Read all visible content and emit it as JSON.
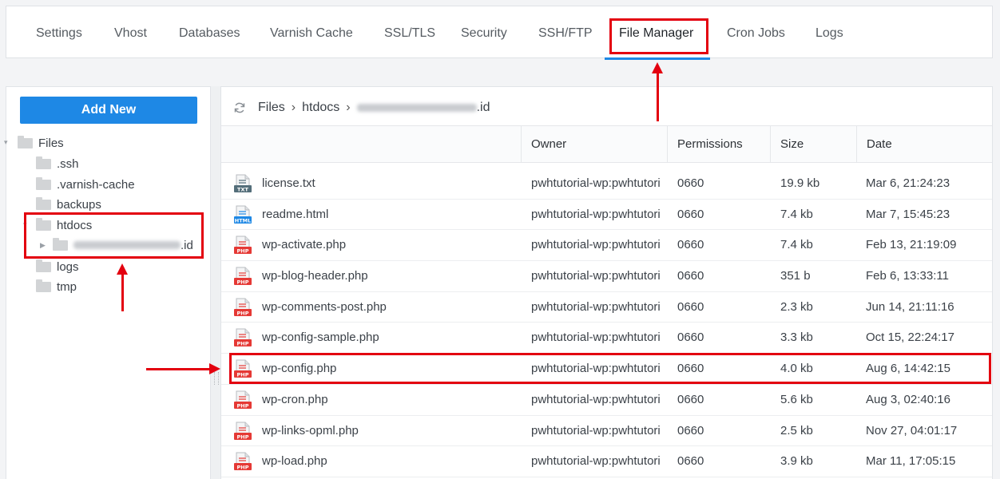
{
  "tabs": [
    "Settings",
    "Vhost",
    "Databases",
    "Varnish Cache",
    "SSL/TLS",
    "Security",
    "SSH/FTP",
    "File Manager",
    "Cron Jobs",
    "Logs"
  ],
  "active_tab": "File Manager",
  "left": {
    "add_new_label": "Add New",
    "tree": {
      "root": "Files",
      "items": [
        ".ssh",
        ".varnish-cache",
        "backups",
        "htdocs",
        "logs",
        "tmp"
      ],
      "htdocs_child_suffix": ".id"
    }
  },
  "breadcrumb": {
    "root": "Files",
    "folder": "htdocs",
    "sep": "›",
    "site_suffix": ".id"
  },
  "columns": {
    "name": "",
    "owner": "Owner",
    "permissions": "Permissions",
    "size": "Size",
    "date": "Date"
  },
  "files": [
    {
      "name": "license.txt",
      "icon": "txt-file-icon",
      "owner": "pwhtutorial-wp:pwhtutori",
      "perm": "0660",
      "size": "19.9 kb",
      "date": "Mar 6, 21:24:23"
    },
    {
      "name": "readme.html",
      "icon": "html-file-icon",
      "owner": "pwhtutorial-wp:pwhtutori",
      "perm": "0660",
      "size": "7.4 kb",
      "date": "Mar 7, 15:45:23"
    },
    {
      "name": "wp-activate.php",
      "icon": "php-file-icon",
      "owner": "pwhtutorial-wp:pwhtutori",
      "perm": "0660",
      "size": "7.4 kb",
      "date": "Feb 13, 21:19:09"
    },
    {
      "name": "wp-blog-header.php",
      "icon": "php-file-icon",
      "owner": "pwhtutorial-wp:pwhtutori",
      "perm": "0660",
      "size": "351 b",
      "date": "Feb 6, 13:33:11"
    },
    {
      "name": "wp-comments-post.php",
      "icon": "php-file-icon",
      "owner": "pwhtutorial-wp:pwhtutori",
      "perm": "0660",
      "size": "2.3 kb",
      "date": "Jun 14, 21:11:16"
    },
    {
      "name": "wp-config-sample.php",
      "icon": "php-file-icon",
      "owner": "pwhtutorial-wp:pwhtutori",
      "perm": "0660",
      "size": "3.3 kb",
      "date": "Oct 15, 22:24:17"
    },
    {
      "name": "wp-config.php",
      "icon": "php-file-icon",
      "owner": "pwhtutorial-wp:pwhtutori",
      "perm": "0660",
      "size": "4.0 kb",
      "date": "Aug 6, 14:42:15"
    },
    {
      "name": "wp-cron.php",
      "icon": "php-file-icon",
      "owner": "pwhtutorial-wp:pwhtutori",
      "perm": "0660",
      "size": "5.6 kb",
      "date": "Aug 3, 02:40:16"
    },
    {
      "name": "wp-links-opml.php",
      "icon": "php-file-icon",
      "owner": "pwhtutorial-wp:pwhtutori",
      "perm": "0660",
      "size": "2.5 kb",
      "date": "Nov 27, 04:01:17"
    },
    {
      "name": "wp-load.php",
      "icon": "php-file-icon",
      "owner": "pwhtutorial-wp:pwhtutori",
      "perm": "0660",
      "size": "3.9 kb",
      "date": "Mar 11, 17:05:15"
    }
  ],
  "icon_labels": {
    "txt": "TXT",
    "html": "HTML",
    "php": "PHP"
  },
  "colors": {
    "accent": "#1e88e5",
    "annotation": "#e3000f",
    "php": "#e53935",
    "html": "#1e88e5",
    "txt": "#546e7a"
  }
}
